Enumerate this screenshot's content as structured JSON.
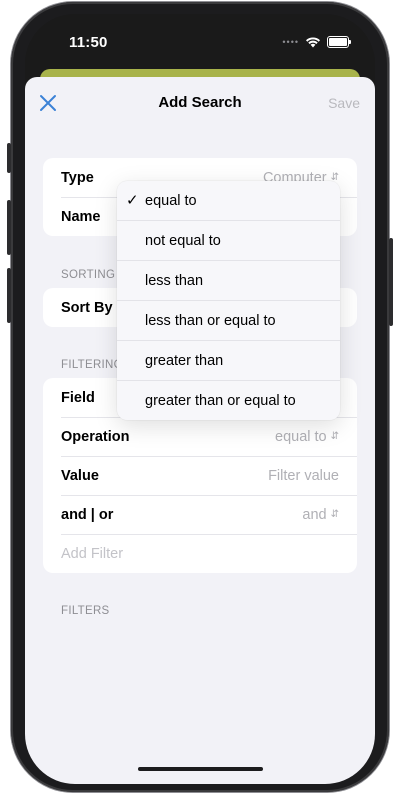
{
  "status_bar": {
    "time": "11:50",
    "signal_dots": "••••"
  },
  "nav": {
    "title": "Add Search",
    "save_label": "Save"
  },
  "basic_group": {
    "rows": [
      {
        "label": "Type",
        "value": "Computer"
      },
      {
        "label": "Name",
        "value": ""
      }
    ]
  },
  "sorting": {
    "header": "SORTING O",
    "rows": [
      {
        "label": "Sort By"
      }
    ]
  },
  "filtering": {
    "header": "FILTERING",
    "rows": [
      {
        "label": "Field",
        "value": ""
      },
      {
        "label": "Operation",
        "value": "equal to"
      },
      {
        "label": "Value",
        "placeholder": "Filter value"
      },
      {
        "label": "and | or",
        "value": "and"
      }
    ],
    "add_filter_label": "Add Filter"
  },
  "filters_header": "FILTERS",
  "operation_menu": {
    "check_mark": "✓",
    "selected_index": 0,
    "items": [
      "equal to",
      "not equal to",
      "less than",
      "less than or equal to",
      "greater than",
      "greater than or equal to"
    ]
  },
  "icons": {
    "close": "close-icon",
    "wifi": "wifi-icon",
    "battery": "battery-icon",
    "chevron": "up-down-chevron-icon",
    "checkmark": "checkmark-icon"
  },
  "colors": {
    "accent": "#3b82d6",
    "header_strip": "#a8b34a",
    "background": "#f2f2f7",
    "secondary_text": "#b0b0b5"
  }
}
